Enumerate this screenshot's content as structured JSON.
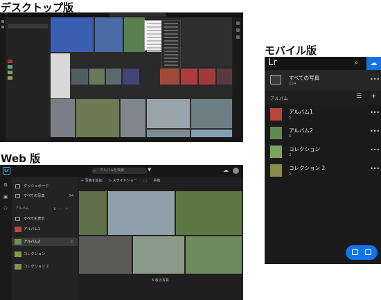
{
  "sections": {
    "desktop_title": "デスクトップ版",
    "mobile_title": "モバイル版",
    "web_title": "Web 版"
  },
  "web": {
    "logo": "Lr",
    "search_placeholder": "アルバムを検索",
    "sidebar": {
      "dashboard": "ダッシュボード",
      "all_photos": "すべての写真",
      "all_photos_count": "54",
      "albums_header": "アルバム",
      "show_all": "すべてを表示",
      "items": [
        {
          "label": "アルバム1"
        },
        {
          "label": "アルバム2"
        },
        {
          "label": "コレクション"
        },
        {
          "label": "コレクション 2"
        }
      ]
    },
    "toolbar": {
      "add_photos": "＋ 写真を追加",
      "slideshow": "▷ スライドショー",
      "share": "共有"
    },
    "photo_count": "6 枚の写真"
  },
  "mobile": {
    "app_title": "Lr",
    "all_photos": "すべての写真",
    "all_photos_count": "154",
    "albums_header": "アルバム",
    "items": [
      {
        "label": "アルバム1",
        "count": "5"
      },
      {
        "label": "アルバム2",
        "count": "6"
      },
      {
        "label": "コレクション",
        "count": "2"
      },
      {
        "label": "コレクション 2",
        "count": "5"
      }
    ]
  },
  "colors": {
    "accent": "#1473e6",
    "lr_blue": "#31a8ff"
  }
}
